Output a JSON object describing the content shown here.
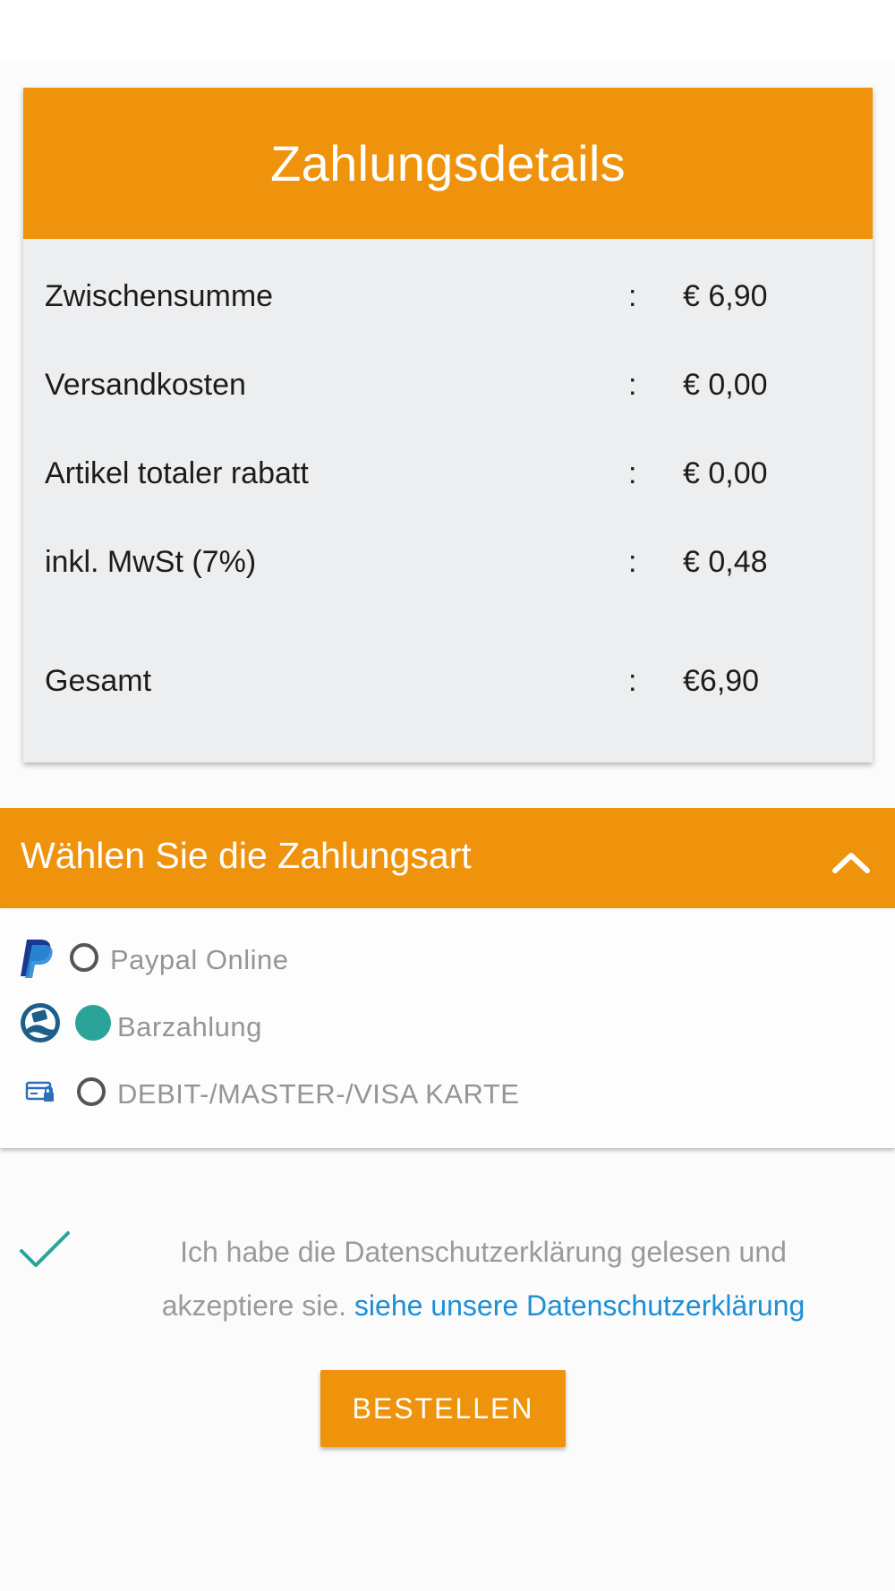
{
  "payment_details": {
    "title": "Zahlungsdetails",
    "colon": ":",
    "rows": [
      {
        "label": "Zwischensumme",
        "value": "€ 6,90"
      },
      {
        "label": "Versandkosten",
        "value": "€ 0,00"
      },
      {
        "label": "Artikel totaler rabatt",
        "value": "€ 0,00"
      },
      {
        "label": "inkl. MwSt (7%)",
        "value": "€ 0,48"
      }
    ],
    "total": {
      "label": "Gesamt",
      "value": "€6,90"
    }
  },
  "payment_method": {
    "title": "Wählen Sie die Zahlungsart",
    "toggle_icon": "chevron-up-icon",
    "options": [
      {
        "label": "Paypal Online",
        "icon": "paypal-icon",
        "selected": false
      },
      {
        "label": "Barzahlung",
        "icon": "cash-icon",
        "selected": true
      },
      {
        "label": "DEBIT-/MASTER-/VISA KARTE",
        "icon": "credit-card-icon",
        "selected": false
      }
    ]
  },
  "privacy": {
    "checked": true,
    "text_line1": "Ich habe die Datenschutzerklärung gelesen und",
    "text_line2": "akzeptiere sie.",
    "link": "siehe unsere Datenschutzerklärung"
  },
  "order_button": "BESTELLEN",
  "colors": {
    "accent": "#ef930c",
    "selected_radio": "#2aa498",
    "link": "#1d8fd6"
  }
}
